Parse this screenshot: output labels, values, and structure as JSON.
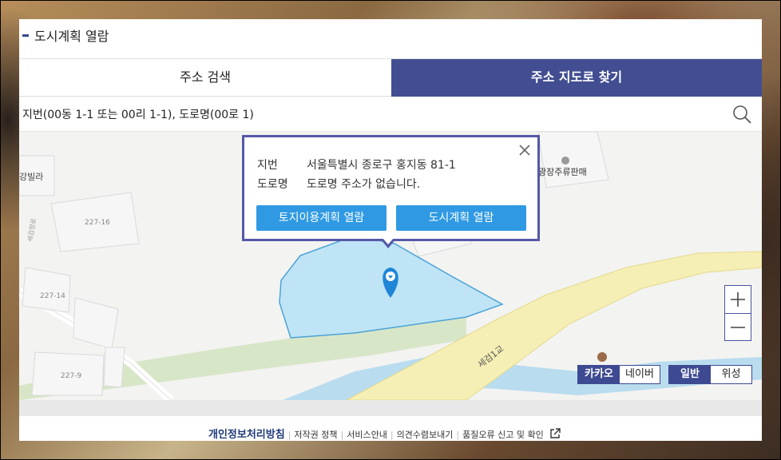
{
  "header": {
    "title": "도시계획 열람"
  },
  "tabs": [
    {
      "label": "주소 검색",
      "active": false
    },
    {
      "label": "주소 지도로 찾기",
      "active": true
    }
  ],
  "search": {
    "placeholder": "지번(00동 1-1 또는 00리 1-1), 도로명(00로 1)"
  },
  "map": {
    "labels": {
      "villa": "강빌라",
      "parcel1": "227-16",
      "parcel2": "227-14",
      "parcel3": "227-9",
      "store": "광장주류판매",
      "bridge": "세검1교",
      "road": "세검정로"
    },
    "colors": {
      "selected_fill": "#bfe4f6",
      "selected_stroke": "#4aa3d6",
      "road": "#f6efb5",
      "river": "#b9dcef",
      "green": "#d8e6c8"
    }
  },
  "popup": {
    "jibun_label": "지번",
    "jibun_value": "서울특별시 종로구 홍지동 81-1",
    "road_label": "도로명",
    "road_value": "도로명 주소가 없습니다.",
    "btn_land": "토지이용계획 열람",
    "btn_city": "도시계획 열람"
  },
  "map_provider": {
    "kakao": "카카오",
    "naver": "네이버",
    "selected": "카카오"
  },
  "map_type": {
    "normal": "일반",
    "satellite": "위성",
    "selected": "일반"
  },
  "footer": {
    "privacy": "개인정보처리방침",
    "copyright": "저작권 정책",
    "service": "서비스안내",
    "opinion": "의견수렴보내기",
    "report": "품질오류 신고 및 확인"
  }
}
